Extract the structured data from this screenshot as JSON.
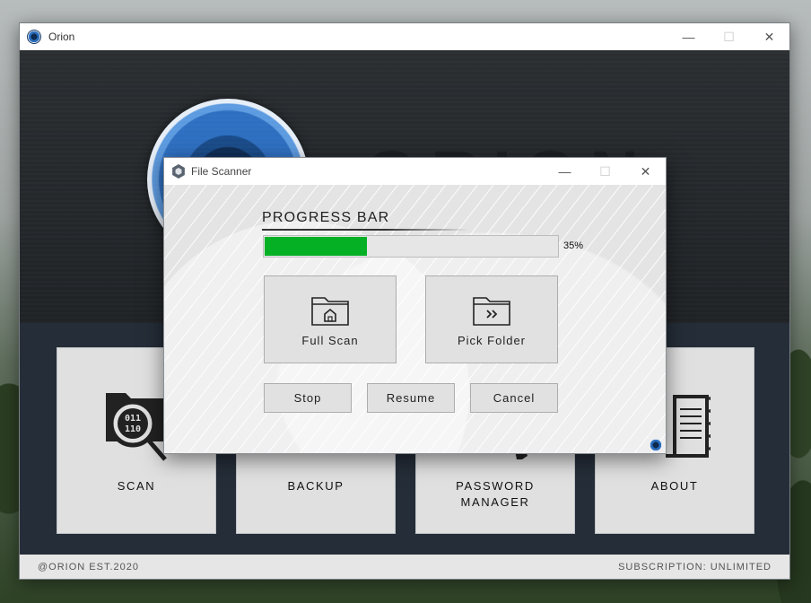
{
  "main_window": {
    "title": "Orion",
    "wordmark": "ORION",
    "controls": {
      "minimize": "—",
      "maximize": "☐",
      "close": "✕"
    },
    "tiles": [
      {
        "label": "SCAN",
        "icon": "scan-binary-icon"
      },
      {
        "label": "BACKUP",
        "icon": "backup-icon"
      },
      {
        "label": "PASSWORD\nMANAGER",
        "icon": "password-gear-icon"
      },
      {
        "label": "ABOUT",
        "icon": "about-document-icon"
      }
    ],
    "footer": {
      "left": "@ORION EST.2020",
      "right": "SUBSCRIPTION: UNLIMITED"
    }
  },
  "dialog": {
    "title": "File Scanner",
    "controls": {
      "minimize": "—",
      "maximize": "☐",
      "close": "✕"
    },
    "heading": "PROGRESS BAR",
    "progress": {
      "value": 35,
      "label": "35%"
    },
    "full_scan": "Full Scan",
    "pick_folder": "Pick Folder",
    "stop": "Stop",
    "resume": "Resume",
    "cancel": "Cancel"
  },
  "colors": {
    "progress_fill": "#06b025",
    "accent_blue": "#2b6fbf",
    "tiles_bg": "#252d38"
  }
}
